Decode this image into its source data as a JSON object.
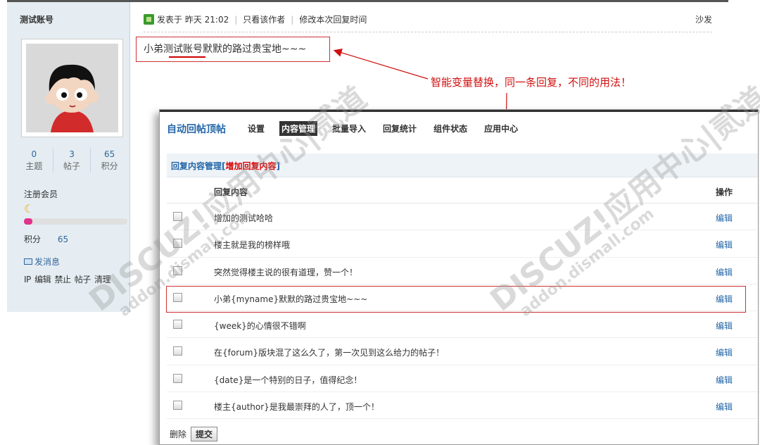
{
  "user": {
    "name": "测试账号",
    "stats": [
      {
        "value": "0",
        "label": "主题"
      },
      {
        "value": "3",
        "label": "帖子"
      },
      {
        "value": "65",
        "label": "积分"
      }
    ],
    "group": "注册会员",
    "level_progress": 0.08,
    "points_label": "积分",
    "points_value": "65",
    "send_message": "发消息",
    "admin_links": [
      "IP",
      "编辑",
      "禁止",
      "帖子",
      "清理"
    ]
  },
  "post": {
    "posted_at": "发表于 昨天 21:02",
    "author_only": "只看该作者",
    "edit_time": "修改本次回复时间",
    "floor": "沙发",
    "content": "小弟测试账号默默的路过贵宝地~~~"
  },
  "annotation": "智能变量替换，同一条回复，不同的用法！",
  "admin": {
    "title": "自动回帖顶帖",
    "nav": [
      {
        "label": "设置",
        "active": false
      },
      {
        "label": "内容管理",
        "active": true
      },
      {
        "label": "批量导入",
        "active": false
      },
      {
        "label": "回复统计",
        "active": false
      },
      {
        "label": "组件状态",
        "active": false
      },
      {
        "label": "应用中心",
        "active": false
      }
    ],
    "section_title": "回复内容管理",
    "add_link": "增加回复内容",
    "col_content": "回复内容",
    "col_action": "操作",
    "rows": [
      {
        "text": "增加的测试哈哈",
        "action": "编辑"
      },
      {
        "text": "楼主就是我的榜样哦",
        "action": "编辑"
      },
      {
        "text": "突然觉得楼主说的很有道理，赞一个！",
        "action": "编辑"
      },
      {
        "text": "小弟{myname}默默的路过贵宝地~~~",
        "action": "编辑"
      },
      {
        "text": "{week}的心情很不错啊",
        "action": "编辑"
      },
      {
        "text": "在{forum}版块混了这么久了，第一次见到这么给力的帖子！",
        "action": "编辑"
      },
      {
        "text": "{date}是一个特别的日子，值得纪念！",
        "action": "编辑"
      },
      {
        "text": "楼主{author}是我最崇拜的人了，顶一个！",
        "action": "编辑"
      }
    ],
    "delete_label": "删除",
    "submit_label": "提交"
  },
  "watermark": {
    "brand": "DISCUZ!应用中心|贰道",
    "domain": "addon.dismall.com"
  },
  "colors": {
    "accent_blue": "#2366a8",
    "highlight_red": "#cc3333",
    "panel_bg": "#e5edf2"
  }
}
